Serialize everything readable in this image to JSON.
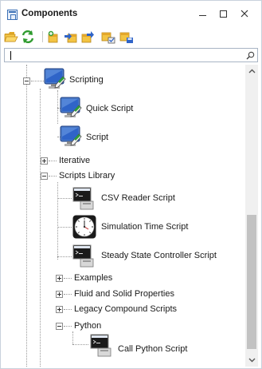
{
  "window": {
    "title": "Components"
  },
  "toolbar": {
    "buttons": [
      {
        "name": "open-folder-icon"
      },
      {
        "name": "refresh-icon"
      },
      {
        "name": "add-component-icon"
      },
      {
        "name": "move-component-icon"
      },
      {
        "name": "export-component-icon"
      },
      {
        "name": "lock-component-icon"
      },
      {
        "name": "save-component-icon"
      }
    ]
  },
  "search": {
    "value": "",
    "placeholder": ""
  },
  "tree": {
    "scripting": "Scripting",
    "quick_script": "Quick Script",
    "script": "Script",
    "iterative": "Iterative",
    "scripts_library": "Scripts Library",
    "csv_reader_script": "CSV Reader Script",
    "simulation_time_script": "Simulation Time Script",
    "steady_state_controller_script": "Steady State Controller Script",
    "examples": "Examples",
    "fluid_and_solid_properties": "Fluid and Solid Properties",
    "legacy_compound_scripts": "Legacy Compound Scripts",
    "python": "Python",
    "call_python_script": "Call Python Script"
  },
  "colors": {
    "accent": "#3a6fb5",
    "monitor": "#2f64c8",
    "pencil": "#2e9d3a"
  }
}
